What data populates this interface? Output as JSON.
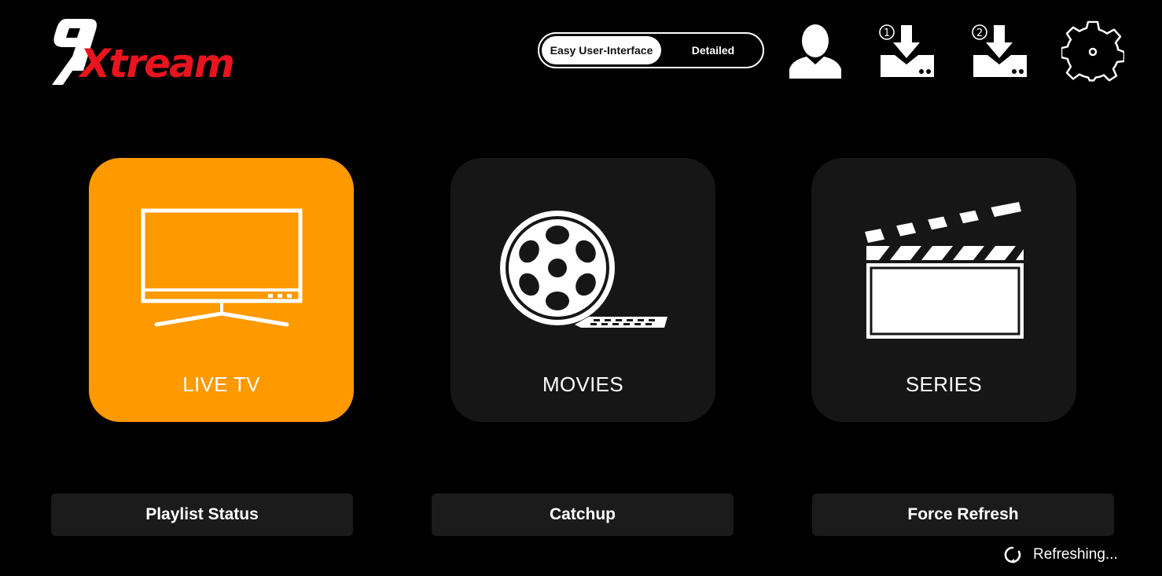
{
  "app": {
    "logo_text": "9Xtream"
  },
  "mode_toggle": {
    "easy_label": "Easy User-Interface",
    "detailed_label": "Detailed",
    "selected": "Easy User-Interface"
  },
  "header_icons": {
    "profile": "user-icon",
    "download_1": {
      "icon": "download-icon",
      "badge": "①"
    },
    "download_2": {
      "icon": "download-icon",
      "badge": "②"
    },
    "settings": "gear-icon"
  },
  "cards": [
    {
      "label": "LIVE TV",
      "icon": "tv-icon",
      "active": true
    },
    {
      "label": "MOVIES",
      "icon": "film-reel-icon",
      "active": false
    },
    {
      "label": "SERIES",
      "icon": "clapperboard-icon",
      "active": false
    }
  ],
  "bottom_buttons": [
    {
      "label": "Playlist Status"
    },
    {
      "label": "Catchup"
    },
    {
      "label": "Force Refresh"
    }
  ],
  "status": {
    "icon": "refresh-icon",
    "text": "Refreshing..."
  },
  "colors": {
    "accent": "#fe9900",
    "logo_red": "#e8141e",
    "card_bg": "#161616",
    "button_bg": "#1b1b1b"
  }
}
